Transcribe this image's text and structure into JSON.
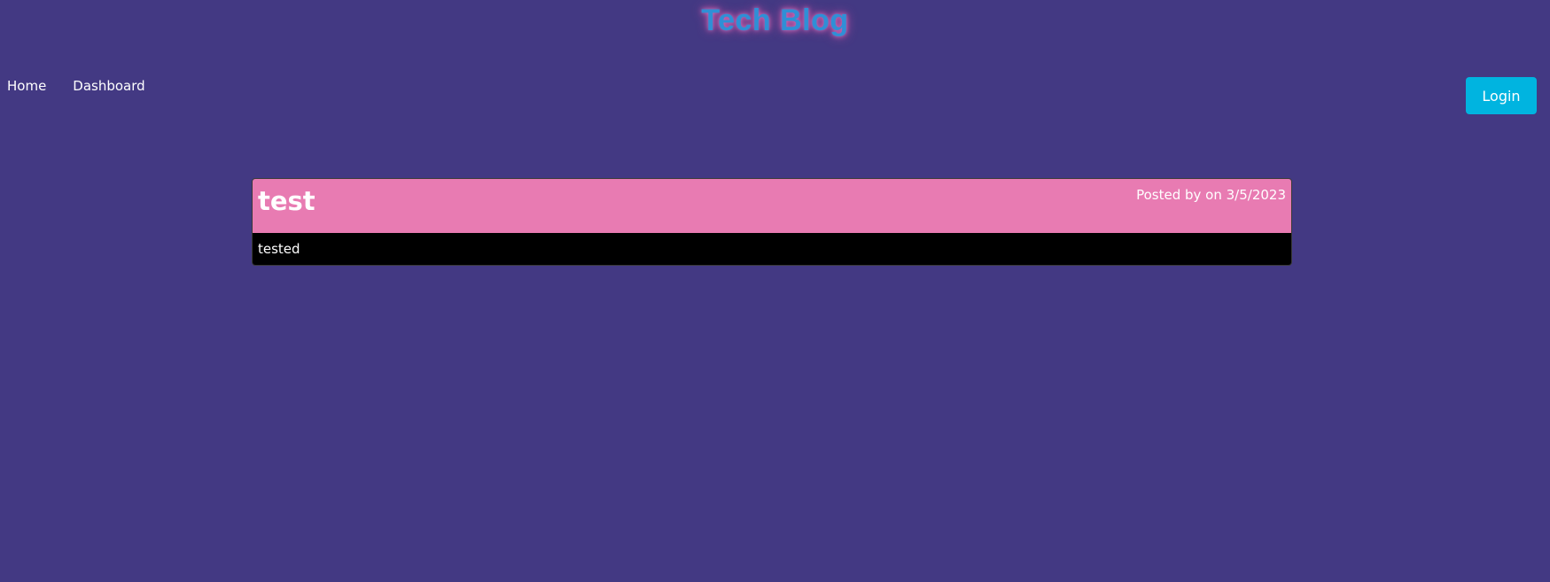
{
  "header": {
    "title": "Tech Blog"
  },
  "nav": {
    "items": [
      {
        "label": "Home"
      },
      {
        "label": "Dashboard"
      }
    ],
    "login_label": "Login"
  },
  "posts": [
    {
      "title": "test",
      "meta": "Posted by on 3/5/2023",
      "body": "tested"
    }
  ],
  "colors": {
    "background": "#433983",
    "title": "#2f8fd6",
    "title_glow": "#e86bb6",
    "login_button": "#00b4e0",
    "post_header": "#e87bb2",
    "post_body": "#000000"
  }
}
